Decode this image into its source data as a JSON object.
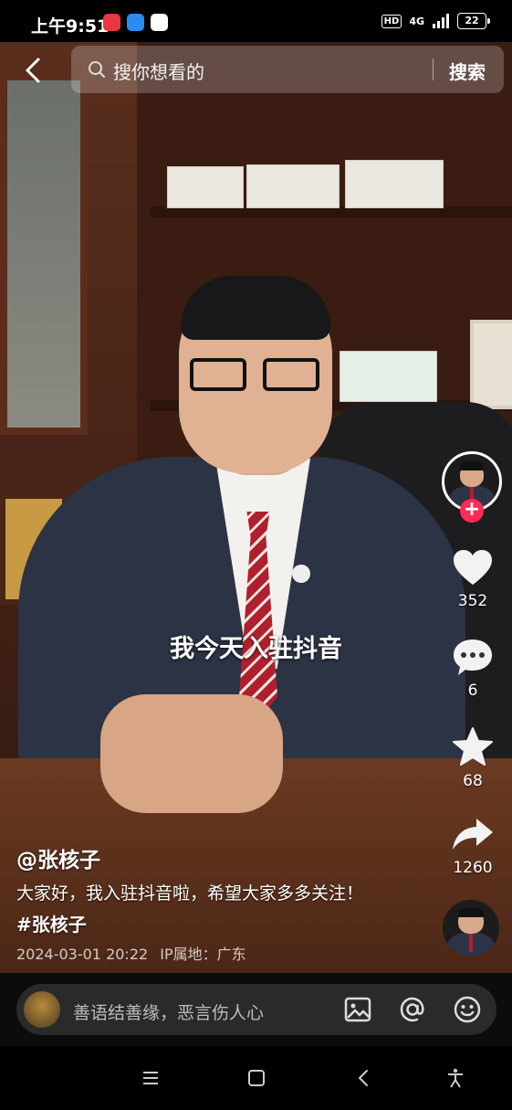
{
  "status_bar": {
    "time": "上午9:51",
    "network": "4G",
    "hd": "HD",
    "battery": "22",
    "apps": [
      {
        "icon": "red-app-icon",
        "color": "#e8383d"
      },
      {
        "icon": "blue-app-icon",
        "color": "#2a8cf0"
      },
      {
        "icon": "58-app-icon",
        "color": "#ffffff"
      }
    ]
  },
  "search": {
    "placeholder": "搜你想看的",
    "button": "搜索"
  },
  "video": {
    "caption": "我今天入驻抖音"
  },
  "rail": {
    "likes": "352",
    "comments": "6",
    "favorites": "68",
    "shares": "1260"
  },
  "info": {
    "author": "@张核子",
    "description": "大家好，我入驻抖音啦，希望大家多多关注！",
    "hashtag": "#张核子",
    "datetime": "2024-03-01 20:22",
    "ip_label": "IP属地：广东"
  },
  "comment_bar": {
    "placeholder": "善语结善缘，恶言伤人心"
  },
  "colors": {
    "follow": "#fe2c55"
  }
}
